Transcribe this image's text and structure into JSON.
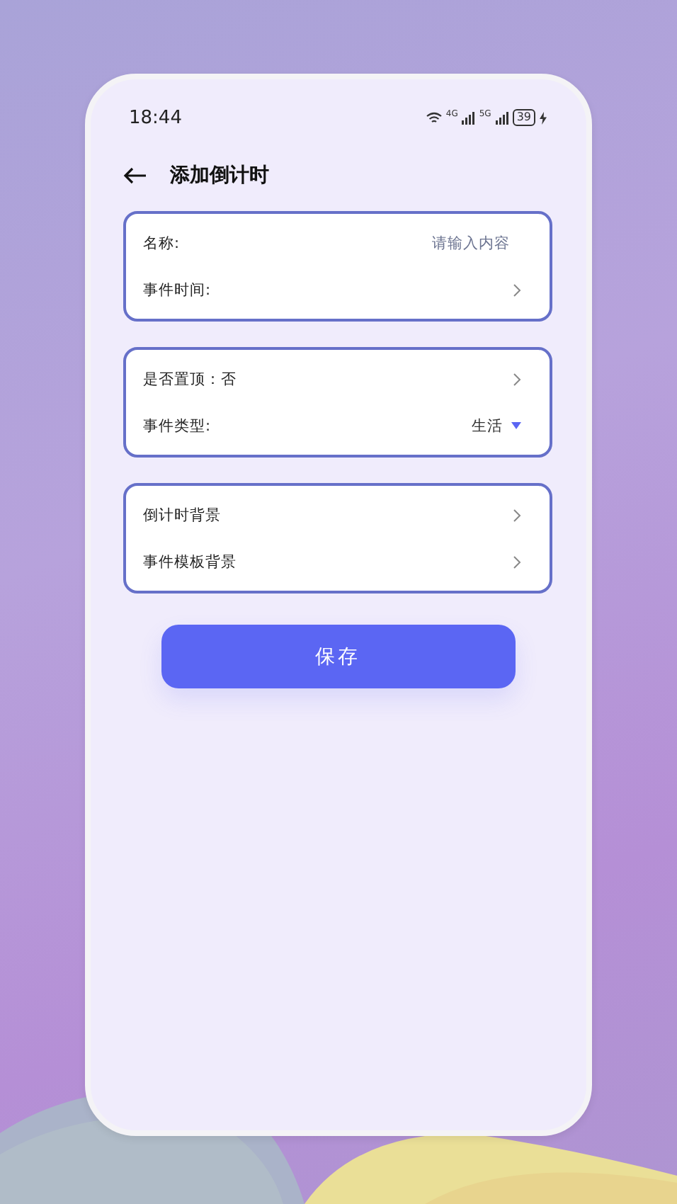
{
  "status_bar": {
    "time": "18:44",
    "networks": [
      "4G",
      "5G"
    ],
    "battery": "39",
    "charging": true
  },
  "header": {
    "title": "添加倒计时"
  },
  "groups": [
    {
      "rows": [
        {
          "kind": "input",
          "label": "名称:",
          "placeholder": "请输入内容"
        },
        {
          "kind": "link",
          "label": "事件时间:"
        }
      ]
    },
    {
      "rows": [
        {
          "kind": "link",
          "label": "是否置顶：否"
        },
        {
          "kind": "select",
          "label": "事件类型:",
          "value": "生活"
        }
      ]
    },
    {
      "rows": [
        {
          "kind": "link",
          "label": "倒计时背景"
        },
        {
          "kind": "link",
          "label": "事件模板背景"
        }
      ]
    }
  ],
  "save_button": "保存"
}
